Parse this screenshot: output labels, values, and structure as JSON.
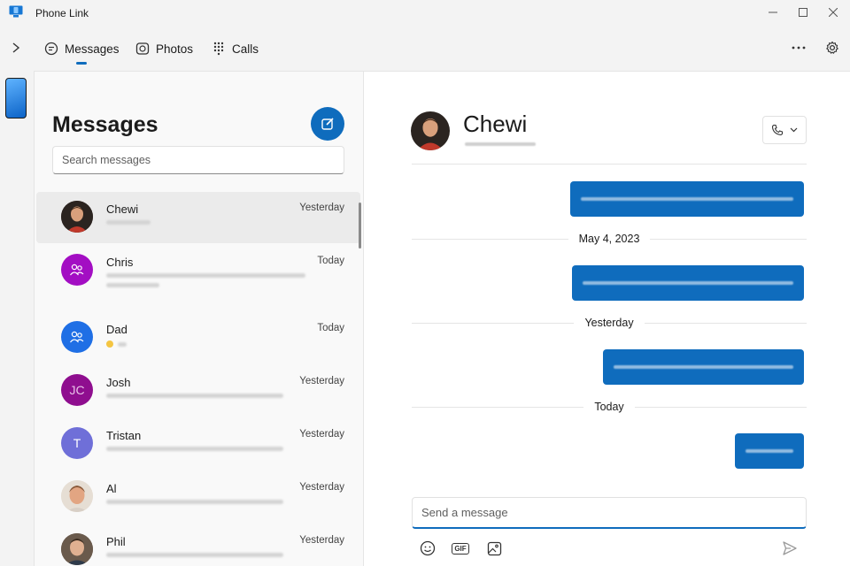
{
  "window": {
    "title": "Phone Link"
  },
  "nav": {
    "tabs": [
      {
        "label": "Messages",
        "icon": "chat-bubble-icon"
      },
      {
        "label": "Photos",
        "icon": "photos-icon"
      },
      {
        "label": "Calls",
        "icon": "dialpad-icon"
      }
    ],
    "active_tab": "Messages"
  },
  "messages_panel": {
    "title": "Messages",
    "search_placeholder": "Search messages",
    "conversations": [
      {
        "name": "Chewi",
        "time": "Yesterday",
        "avatar": "photo",
        "selected": true
      },
      {
        "name": "Chris",
        "time": "Today",
        "avatar": "group",
        "color": "#a30ec3"
      },
      {
        "name": "Dad",
        "time": "Today",
        "avatar": "group",
        "color": "#1f6fe5"
      },
      {
        "name": "Josh",
        "time": "Yesterday",
        "avatar": "initials",
        "initials": "JC",
        "color": "#8f0e8f"
      },
      {
        "name": "Tristan",
        "time": "Yesterday",
        "avatar": "initials",
        "initials": "T",
        "color": "#6f6fd8"
      },
      {
        "name": "Al",
        "time": "Yesterday",
        "avatar": "photo"
      },
      {
        "name": "Phil",
        "time": "Yesterday",
        "avatar": "photo"
      }
    ]
  },
  "chat": {
    "contact_name": "Chewi",
    "date_separators": [
      "May 4, 2023",
      "Yesterday",
      "Today"
    ],
    "composer_placeholder": "Send a message"
  },
  "colors": {
    "accent": "#0f6cbd"
  }
}
